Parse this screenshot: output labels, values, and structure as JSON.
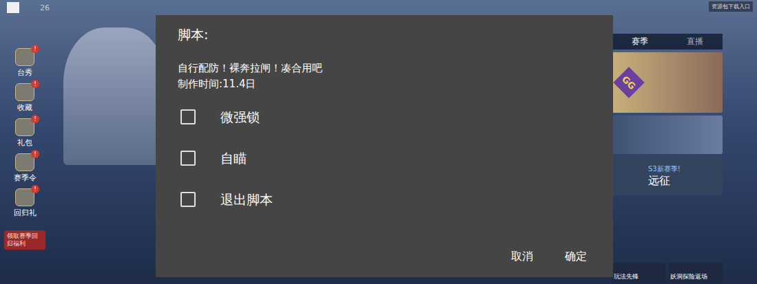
{
  "status": {
    "time": "26"
  },
  "game": {
    "top_notice": "资源包下载入口",
    "side_menu": [
      {
        "label": "台秀",
        "badge": "!"
      },
      {
        "label": "收藏",
        "badge": "!"
      },
      {
        "label": "礼包",
        "badge": "!"
      },
      {
        "label": "赛季令",
        "badge": "!"
      },
      {
        "label": "回归礼",
        "badge": "!"
      }
    ],
    "promo": "领取赛季回归福利",
    "right_tabs": [
      {
        "label": "赛季",
        "selected": true
      },
      {
        "label": "直播",
        "selected": false
      }
    ],
    "cards": [
      {
        "kind": "app",
        "label": "GG"
      },
      {
        "kind": "art"
      },
      {
        "kind": "season",
        "label": "S3新赛季!",
        "sub": "远征"
      }
    ],
    "bottom_cards": [
      "玩法先锋",
      "妖洞探险返场"
    ]
  },
  "dialog": {
    "title": "脚本:",
    "description": [
      "自行配防！裸奔拉闸！凑合用吧",
      "制作时间:11.4日"
    ],
    "options": [
      {
        "label": "微强锁",
        "checked": false
      },
      {
        "label": "自瞄",
        "checked": false
      },
      {
        "label": "退出脚本",
        "checked": false
      }
    ],
    "buttons": [
      {
        "label": "取消"
      },
      {
        "label": "确定"
      }
    ]
  }
}
